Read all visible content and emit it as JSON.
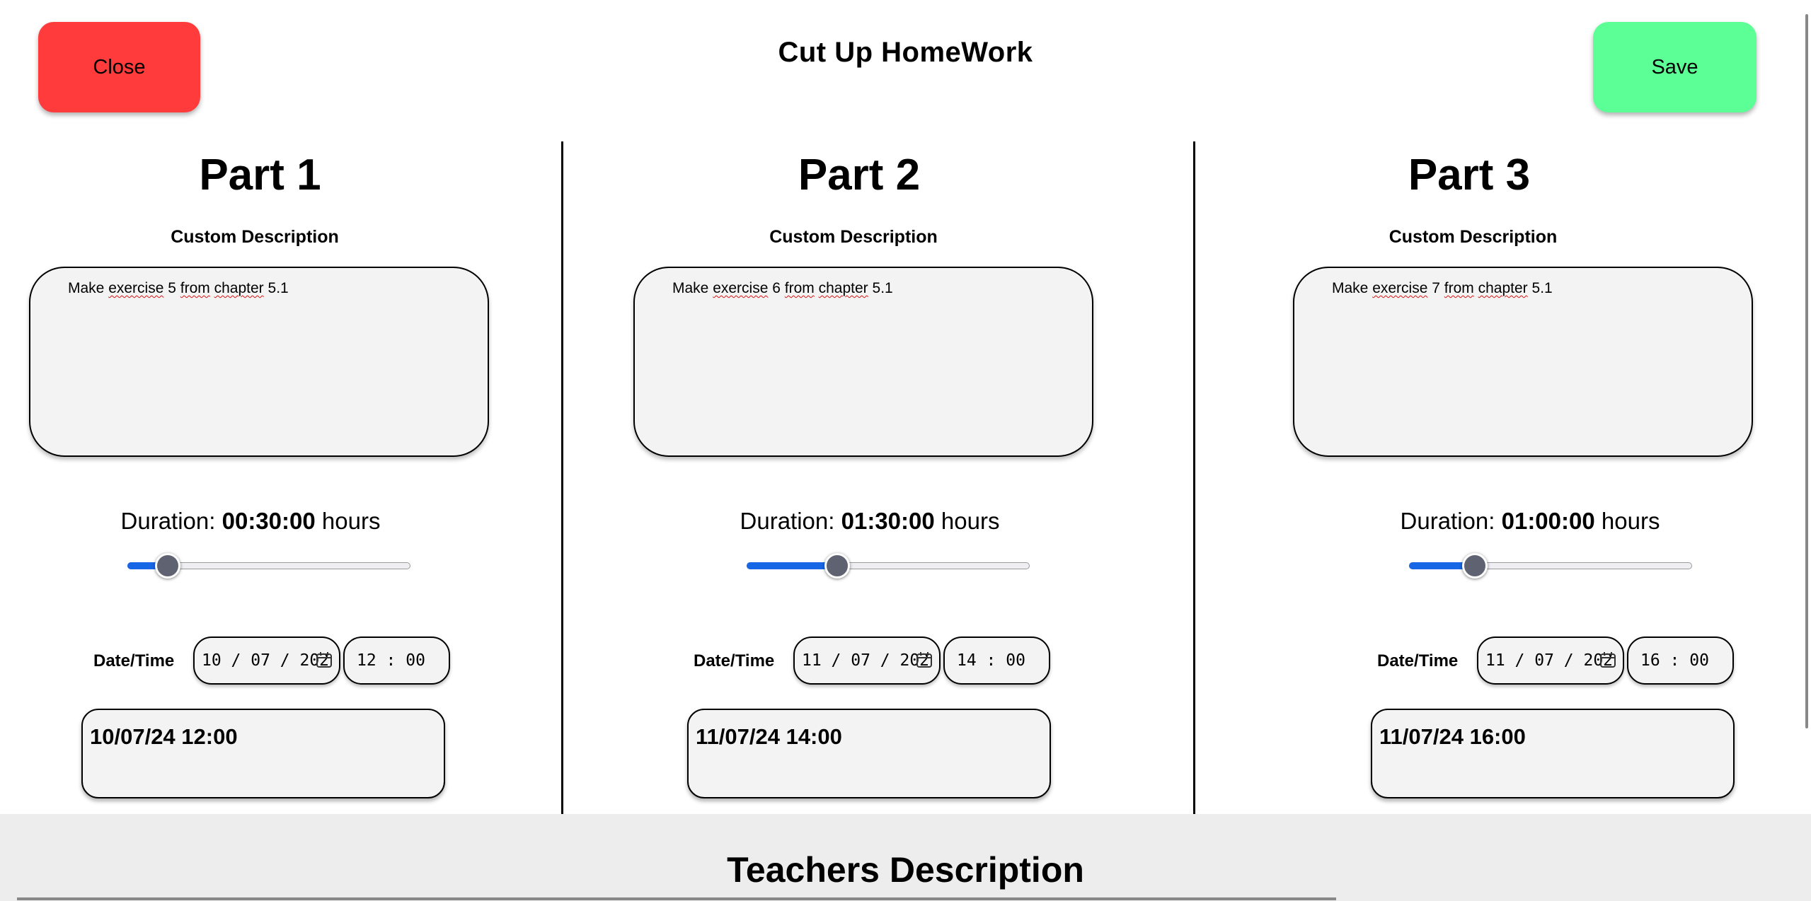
{
  "app": {
    "title": "Cut Up HomeWork",
    "close_label": "Close",
    "save_label": "Save",
    "close_color": "#ff3b3b",
    "save_color": "#5cff96"
  },
  "parts": [
    {
      "title": "Part 1",
      "custom_description_label": "Custom Description",
      "description_words": [
        "Make",
        "exercise",
        "5",
        "from",
        "chapter",
        "5.1"
      ],
      "duration_label": "Duration:",
      "duration_value": "00:30:00",
      "duration_unit": "hours",
      "slider_fraction": 0.14,
      "date_time_label": "Date/Time",
      "date_input": "10 / 07 / 202",
      "time_input": "12 : 00",
      "result": "10/07/24 12:00"
    },
    {
      "title": "Part 2",
      "custom_description_label": "Custom Description",
      "description_words": [
        "Make",
        "exercise",
        "6",
        "from",
        "chapter",
        "5.1"
      ],
      "duration_label": "Duration:",
      "duration_value": "01:30:00",
      "duration_unit": "hours",
      "slider_fraction": 0.32,
      "date_time_label": "Date/Time",
      "date_input": "11 / 07 / 202",
      "time_input": "14 : 00",
      "result": "11/07/24 14:00"
    },
    {
      "title": "Part 3",
      "custom_description_label": "Custom Description",
      "description_words": [
        "Make",
        "exercise",
        "7",
        "from",
        "chapter",
        "5.1"
      ],
      "duration_label": "Duration:",
      "duration_value": "01:00:00",
      "duration_unit": "hours",
      "slider_fraction": 0.23,
      "date_time_label": "Date/Time",
      "date_input": "11 / 07 / 202",
      "time_input": "16 : 00",
      "result": "11/07/24 16:00"
    }
  ],
  "teachers": {
    "title": "Teachers Description"
  },
  "colors": {
    "slider_fill": "#1766e6",
    "slider_thumb": "#5f6270",
    "field_background": "#f3f3f3",
    "teachers_background": "#ededed"
  },
  "icons": [
    "calendar-icon"
  ]
}
